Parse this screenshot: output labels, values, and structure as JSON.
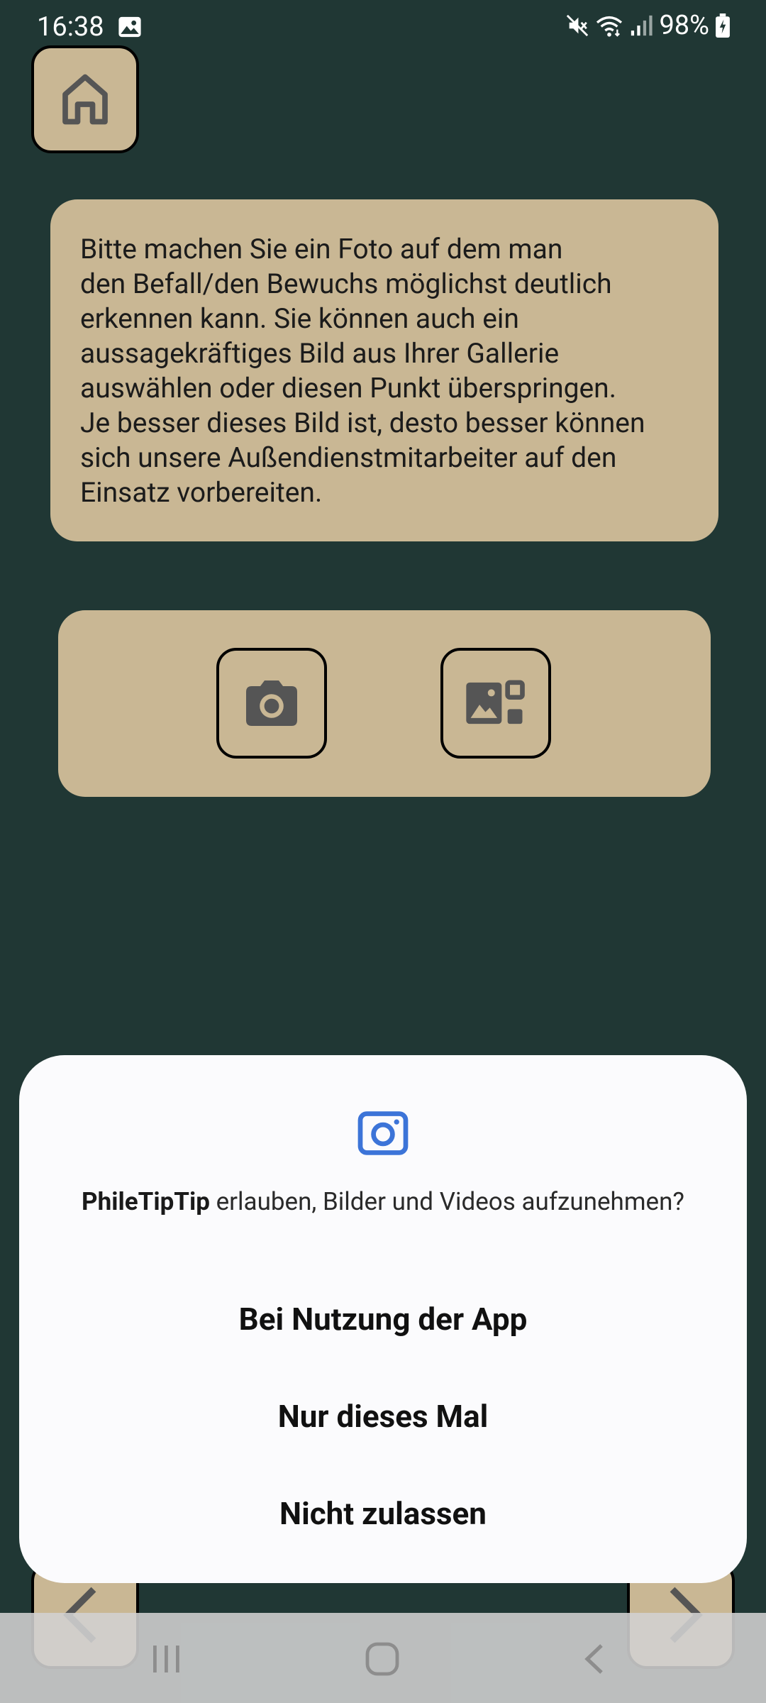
{
  "status_bar": {
    "time": "16:38",
    "battery": "98%",
    "icons": [
      "image-notification-icon",
      "mute-icon",
      "wifi-icon",
      "signal-icon",
      "battery-charging-icon"
    ]
  },
  "home_button": {
    "icon": "home-icon"
  },
  "info": {
    "text": "Bitte machen Sie ein Foto auf dem man\nden Befall/den Bewuchs möglichst deutlich\nerkennen kann. Sie können auch ein\naussagekräftiges Bild aus Ihrer Gallerie\nauswählen oder diesen Punkt überspringen.\nJe besser dieses Bild ist, desto besser können\nsich unsere Außendienstmitarbeiter auf den\nEinsatz vorbereiten."
  },
  "actions": {
    "camera_icon": "camera-icon",
    "gallery_icon": "gallery-icon"
  },
  "navigation": {
    "prev_icon": "arrow-left-icon",
    "next_icon": "arrow-right-icon"
  },
  "permission_dialog": {
    "icon": "camera-icon",
    "app_name": "PhileTipTip",
    "message": " erlauben, Bilder und Videos aufzunehmen?",
    "options": [
      "Bei Nutzung der App",
      "Nur dieses Mal",
      "Nicht zulassen"
    ]
  },
  "system_nav": {
    "icons": [
      "recents-icon",
      "home-circle-icon",
      "back-icon"
    ]
  },
  "colors": {
    "background": "#203734",
    "card": "#c9b794",
    "dialog": "#fbfbfd",
    "dialog_icon": "#3c74d8"
  }
}
